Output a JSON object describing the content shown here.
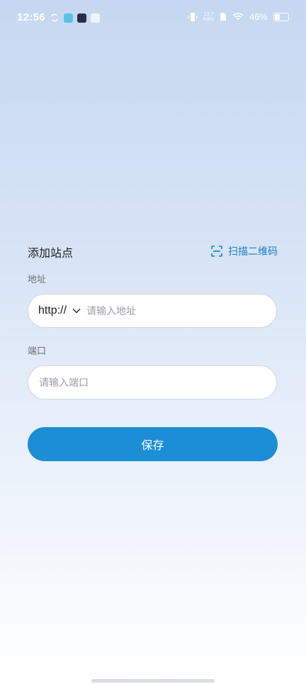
{
  "status_bar": {
    "time": "12:56",
    "speed_value": "13.7",
    "speed_unit": "KB/s",
    "battery": "46%",
    "battery_level": 0.46,
    "left_icons": [
      "sync-icon",
      "app-icon",
      "play-icon",
      "mail-icon"
    ],
    "right_icons": [
      "vibrate-icon",
      "sim-icon",
      "wifi-icon",
      "battery-icon"
    ]
  },
  "form": {
    "title": "添加站点",
    "scan_label": "扫描二维码",
    "address_label": "地址",
    "protocol": "http://",
    "address_placeholder": "请输入地址",
    "port_label": "端口",
    "port_placeholder": "请输入端口",
    "save_label": "保存"
  },
  "colors": {
    "accent": "#1b7fc4",
    "button": "#1b8ed6"
  }
}
